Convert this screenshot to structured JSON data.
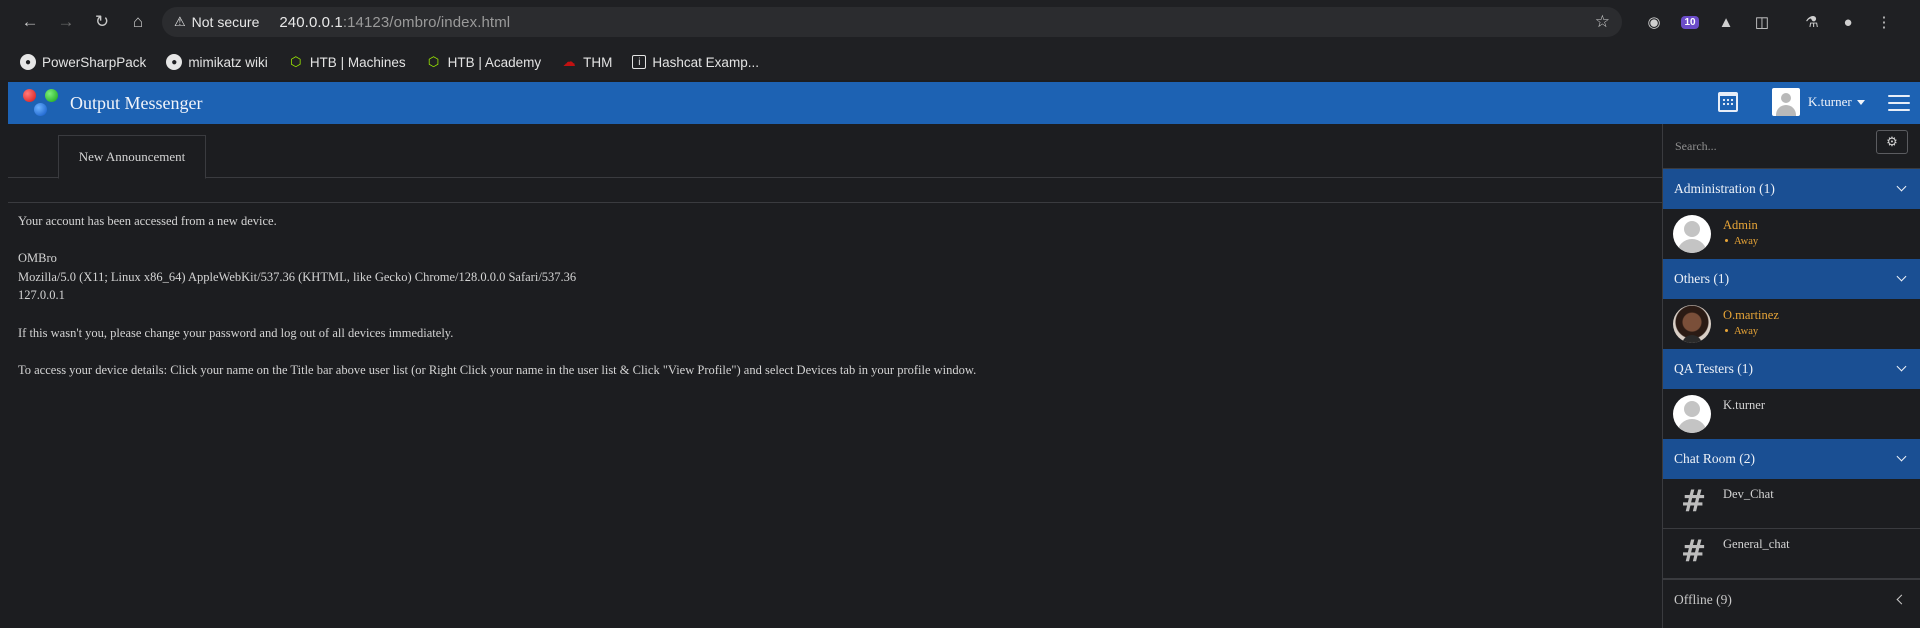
{
  "browser": {
    "security_label": "Not secure",
    "url_host": "240.0.0.1",
    "url_rest": ":14123/ombro/index.html",
    "extension_badge": "10",
    "bookmarks": [
      {
        "label": "PowerSharpPack",
        "icon": "github-icon"
      },
      {
        "label": "mimikatz wiki",
        "icon": "github-icon"
      },
      {
        "label": "HTB | Machines",
        "icon": "htb-icon"
      },
      {
        "label": "HTB | Academy",
        "icon": "htb-icon"
      },
      {
        "label": "THM",
        "icon": "thm-icon"
      },
      {
        "label": "Hashcat Examp...",
        "icon": "hashcat-icon"
      }
    ]
  },
  "app": {
    "title": "Output Messenger",
    "user_name": "K.turner",
    "accent_color": "#1d62b3"
  },
  "main": {
    "tab_label": "New Announcement",
    "message": {
      "line1": "Your account has been accessed from a new device.",
      "line2": "OMBro",
      "line3": "Mozilla/5.0 (X11; Linux x86_64) AppleWebKit/537.36 (KHTML, like Gecko) Chrome/128.0.0.0 Safari/537.36",
      "line4": "127.0.0.1",
      "line5": "If this wasn't you, please change your password and log out of all devices immediately.",
      "line6": "To access your device details: Click your name on the Title bar above user list (or Right Click your name in the user list & Click \"View Profile\") and select Devices tab in your profile window."
    }
  },
  "sidebar": {
    "search_placeholder": "Search...",
    "groups": [
      {
        "label": "Administration (1)",
        "users": [
          {
            "name": "Admin",
            "status": "Away"
          }
        ]
      },
      {
        "label": "Others (1)",
        "users": [
          {
            "name": "O.martinez",
            "status": "Away"
          }
        ]
      },
      {
        "label": "QA Testers (1)",
        "users": [
          {
            "name": "K.turner"
          }
        ]
      },
      {
        "label": "Chat Room (2)",
        "rooms": [
          "Dev_Chat",
          "General_chat"
        ]
      }
    ],
    "offline_label": "Offline (9)"
  }
}
